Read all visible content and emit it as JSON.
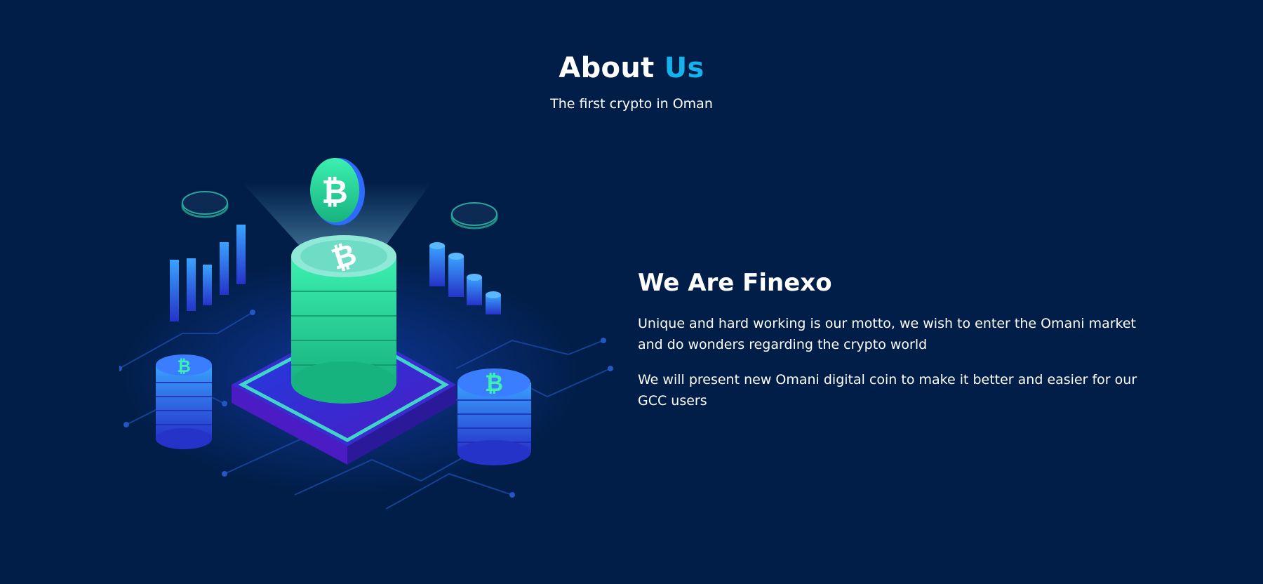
{
  "header": {
    "title_main": "About",
    "title_accent": "Us",
    "subtitle": "The first crypto in Oman"
  },
  "about": {
    "heading": "We Are Finexo",
    "paragraph_1": "Unique and hard working is our motto, we wish to enter the Omani market and do wonders regarding the crypto world",
    "paragraph_2": "We will present new Omani digital coin to make it better and easier for our GCC users"
  },
  "illustration": {
    "description_icon": "isometric-crypto-coins-icon",
    "coin_glyph": "bitcoin-coin-icon"
  },
  "colors": {
    "background": "#011e48",
    "accent": "#15b2ec",
    "text": "#ffffff",
    "coin_green": "#2ee59d",
    "coin_blue": "#2d6bff"
  }
}
